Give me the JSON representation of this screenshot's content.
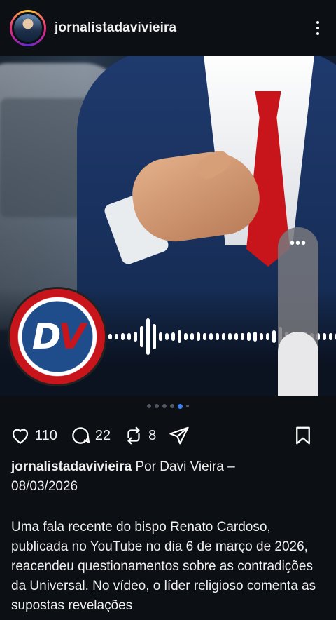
{
  "header": {
    "username": "jornalistadavivieira",
    "more_icon": "more-vertical-icon"
  },
  "media": {
    "logo_text_left": "D",
    "logo_text_right": "V",
    "volume_level": 0.47,
    "volume_menu": "•••",
    "carousel_active_index": 4,
    "carousel_count": 6
  },
  "actions": {
    "likes": "110",
    "comments": "22",
    "reposts": "8"
  },
  "caption": {
    "username": "jornalistadavivieira",
    "byline": "Por Davi Vieira –",
    "date": "08/03/2026",
    "body": "Uma fala recente do bispo Renato Cardoso, publicada no YouTube no dia 6 de março de 2026, reacendeu questionamentos sobre as contradições da Universal. No vídeo, o líder religioso comenta as supostas revelações"
  },
  "colors": {
    "background": "#0c0f14",
    "accent_blue": "#3b82f6",
    "tie_red": "#c8151b"
  }
}
